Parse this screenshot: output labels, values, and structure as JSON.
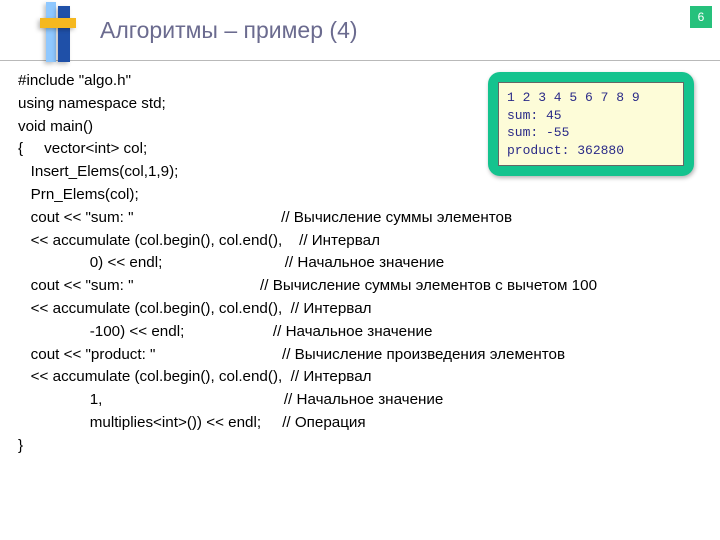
{
  "page_number": "6",
  "title": "Алгоритмы – пример (4)",
  "code": {
    "l1": "#include \"algo.h\"",
    "l2": "using namespace std;",
    "l3": "void main()",
    "l4": "{     vector<int> col;",
    "l5": "   Insert_Elems(col,1,9);",
    "l6": "   Prn_Elems(col);",
    "l7": "   cout << \"sum: \"                                   // Вычисление суммы элементов",
    "l8": "   << accumulate (col.begin(), col.end(),    // Интервал",
    "l9": "                 0) << endl;                             // Начальное значение",
    "l10": "   cout << \"sum: \"                              // Вычисление суммы элементов с вычетом 100",
    "l11": "   << accumulate (col.begin(), col.end(),  // Интервал",
    "l12": "                 -100) << endl;                     // Начальное значение",
    "l13": "",
    "l14": "   cout << \"product: \"                              // Вычисление произведения элементов",
    "l15": "   << accumulate (col.begin(), col.end(),  // Интервал",
    "l16": "                 1,                                           // Начальное значение",
    "l17": "                 multiplies<int>()) << endl;     // Операция",
    "l18": "}"
  },
  "output": {
    "l1": "1 2 3 4 5 6 7 8 9",
    "l2": "sum: 45",
    "l3": "sum: -55",
    "l4": "product: 362880"
  }
}
